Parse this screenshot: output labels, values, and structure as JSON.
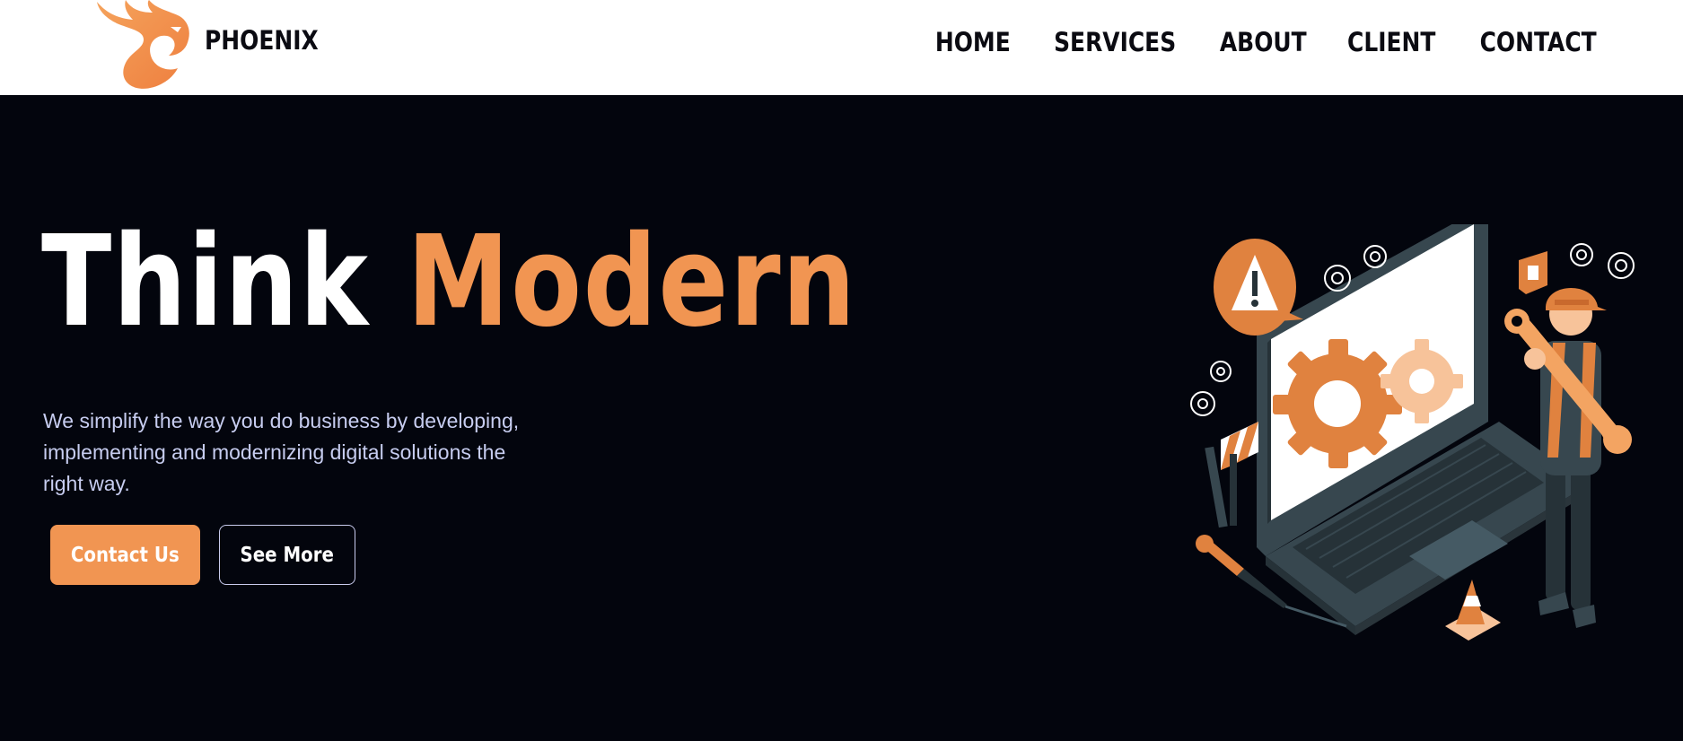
{
  "brand": {
    "name": "PHOENIX",
    "logo_icon": "phoenix-bird-icon"
  },
  "nav": {
    "items": [
      {
        "label": "HOME"
      },
      {
        "label": "SERVICES"
      },
      {
        "label": "ABOUT"
      },
      {
        "label": "CLIENT"
      },
      {
        "label": "CONTACT"
      }
    ]
  },
  "hero": {
    "title_part1": "Think",
    "title_part2": "Modern",
    "tagline": "We simplify the way you do business by developing, implementing and modernizing digital solutions the right way.",
    "primary_button": "Contact Us",
    "secondary_button": "See More",
    "illustration": "worker-fixing-laptop-illustration"
  },
  "colors": {
    "accent": "#f19552",
    "background": "#03050d",
    "navbar": "#ffffff",
    "text_light": "#c7cdf0"
  }
}
